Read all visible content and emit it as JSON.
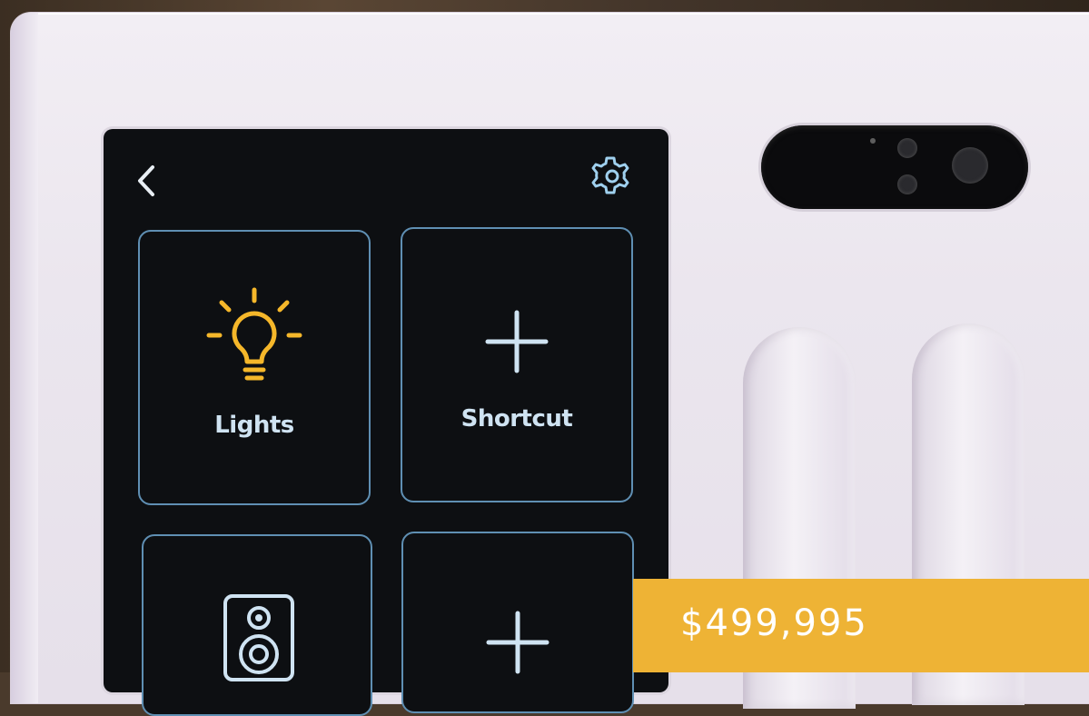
{
  "screen": {
    "back_icon": "chevron-left-icon",
    "settings_icon": "gear-icon",
    "tiles": [
      {
        "label": "Lights",
        "icon": "lightbulb-icon",
        "icon_color": "#f5b72a"
      },
      {
        "label": "Shortcut",
        "icon": "plus-icon",
        "icon_color": "#cfe3f2"
      },
      {
        "label": "",
        "icon": "speaker-icon",
        "icon_color": "#cfe3f2"
      },
      {
        "label": "",
        "icon": "plus-icon",
        "icon_color": "#cfe3f2"
      }
    ]
  },
  "price_badge": {
    "text": "$499,995",
    "color": "#eeb335"
  },
  "colors": {
    "screen_bg": "#0d0f12",
    "tile_border": "#5f8fb3",
    "panel": "#ebe6ee"
  }
}
